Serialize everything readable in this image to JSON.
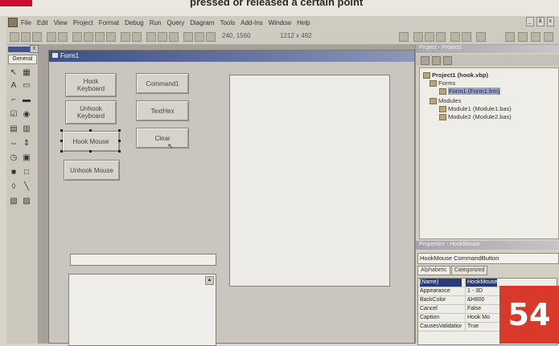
{
  "magazine": {
    "caption": "pressed or released a certain point",
    "page_number": "54"
  },
  "menubar": {
    "items": [
      "File",
      "Edit",
      "View",
      "Project",
      "Format",
      "Debug",
      "Run",
      "Query",
      "Diagram",
      "Tools",
      "Add-Ins",
      "Window",
      "Help"
    ],
    "window_controls": [
      "_",
      "å",
      "x"
    ]
  },
  "toolbar": {
    "position": "240, 1560",
    "size": "1212 x 492"
  },
  "toolbox": {
    "close": "x",
    "tab": "General"
  },
  "form": {
    "title": "Form1",
    "buttons": {
      "hook_keyboard": "Hook\nKeyboard",
      "command1": "Command1",
      "unhook_keyboard": "Unhook\nKeyboard",
      "texthex": "TextHex",
      "hook_mouse": "Hook Mouse",
      "clear": "Clear",
      "unhook_mouse": "Unhook Mouse"
    }
  },
  "project": {
    "title": "Project - Project1",
    "root": "Project1 (hook.vbp)",
    "forms_folder": "Forms",
    "form_item": "Form1 (Form1.frm)",
    "modules_folder": "Modules",
    "module1": "Module1 (Module1.bas)",
    "module2": "Module2 (Module2.bas)"
  },
  "properties": {
    "title": "Properties - HookMouse",
    "object": "HookMouse CommandButton",
    "tabs": [
      "Alphabetic",
      "Categorized"
    ],
    "rows": [
      {
        "name": "(Name)",
        "value": "HookMouse"
      },
      {
        "name": "Appearance",
        "value": "1 - 3D"
      },
      {
        "name": "BackColor",
        "value": "&H800"
      },
      {
        "name": "Cancel",
        "value": "False"
      },
      {
        "name": "Caption",
        "value": "Hook Mo"
      },
      {
        "name": "CausesValidation",
        "value": "True"
      }
    ]
  },
  "colors": {
    "title_bar": "#3c4f86",
    "selection": "#283b74",
    "badge": "#d8392b"
  }
}
